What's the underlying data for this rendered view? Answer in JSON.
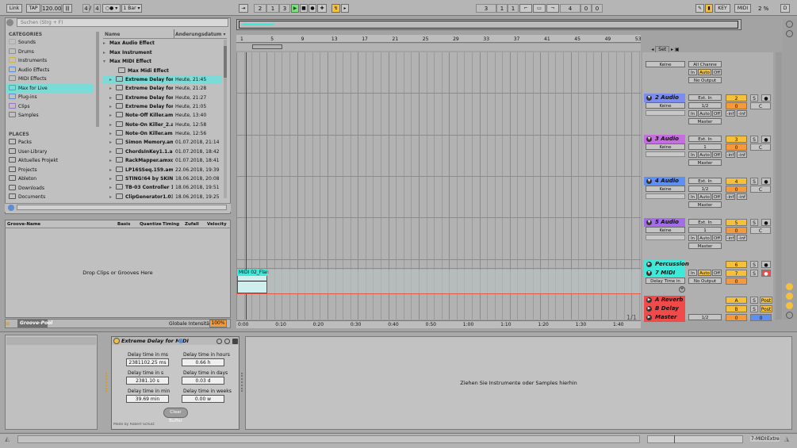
{
  "transport": {
    "link": "Link",
    "tap": "TAP",
    "tempo": "120.00",
    "sig_num": "4",
    "sig_den": "4",
    "metro": "○●",
    "quant": "1 Bar",
    "pos_bar": "2",
    "pos_beat": "1",
    "pos_six": "3",
    "loop_bar": "3",
    "loop_beat": "1",
    "loop_six": "1",
    "len_bar": "4",
    "len_beat": "0",
    "len_six": "0",
    "key": "KEY",
    "midi": "MIDI",
    "cpu": "2 %",
    "d": "D"
  },
  "browser": {
    "search_placeholder": "Suchen (Strg + F)",
    "categories_label": "CATEGORIES",
    "categories": [
      "Sounds",
      "Drums",
      "Instruments",
      "Audio Effects",
      "MIDI Effects",
      "Max for Live",
      "Plug-ins",
      "Clips",
      "Samples"
    ],
    "places_label": "PLACES",
    "places": [
      "Packs",
      "User-Library",
      "Aktuelles Projekt",
      "Projects",
      "Ableton",
      "Downloads",
      "Documents"
    ],
    "col_name": "Name",
    "col_date": "Änderungsdatum",
    "folders": [
      "Max Audio Effect",
      "Max Instrument",
      "Max MIDI Effect"
    ],
    "subfolder": "Max Midi Effect",
    "files": [
      {
        "name": "Extreme Delay for ...",
        "date": "Heute, 21:45"
      },
      {
        "name": "Extreme Delay for ...",
        "date": "Heute, 21:28"
      },
      {
        "name": "Extreme Delay for ...",
        "date": "Heute, 21:27"
      },
      {
        "name": "Extreme Delay for ...",
        "date": "Heute, 21:05"
      },
      {
        "name": "Note-Off Killer.amxd",
        "date": "Heute, 13:40"
      },
      {
        "name": "Note-On Killer_2.a...",
        "date": "Heute, 12:58"
      },
      {
        "name": "Note-On Killer.amxd",
        "date": "Heute, 12:56"
      },
      {
        "name": "Simon Memory.am...",
        "date": "01.07.2018, 21:14"
      },
      {
        "name": "ChordsInKey1.1.a...",
        "date": "01.07.2018, 18:42"
      },
      {
        "name": "RackMapper.amxd",
        "date": "01.07.2018, 18:41"
      },
      {
        "name": "LP16SSeq.159.amxd",
        "date": "22.06.2018, 19:39"
      },
      {
        "name": "STING!64 by SKIN...",
        "date": "18.06.2018, 20:08"
      },
      {
        "name": "TB-03 Controller 1...",
        "date": "18.06.2018, 19:51"
      },
      {
        "name": "ClipGenerator1.03....",
        "date": "18.06.2018, 19:25"
      }
    ]
  },
  "groove": {
    "headers": [
      "Groove-Name",
      "Basis",
      "Quantize",
      "Timing",
      "Zufall",
      "Velocity"
    ],
    "drop_text": "Drop Clips or Grooves Here",
    "pool_label": "Groove-Pool",
    "intensity_label": "Globale Intensität",
    "intensity_value": "100%"
  },
  "arrangement": {
    "ruler_bars": [
      "1",
      "5",
      "9",
      "13",
      "17",
      "21",
      "25",
      "29",
      "33",
      "37",
      "41",
      "45",
      "49",
      "53"
    ],
    "time_marks": [
      "0:00",
      "0:10",
      "0:20",
      "0:30",
      "0:40",
      "0:50",
      "1:00",
      "1:10",
      "1:20",
      "1:30",
      "1:40"
    ],
    "set_label": "Set",
    "fraction": "1/1",
    "clip_name": "MIDI 02_Flan"
  },
  "tracks": [
    {
      "name": "2 Audio",
      "color": "#7b8df0",
      "in": "Ext. In",
      "ch": "1/2",
      "out": "Master",
      "num": "2",
      "vol": "0",
      "pan": "C"
    },
    {
      "name": "3 Audio",
      "color": "#c66ee0",
      "in": "Ext. In",
      "ch": "1",
      "out": "Master",
      "num": "3",
      "vol": "0",
      "pan": "C"
    },
    {
      "name": "4 Audio",
      "color": "#5d8ff5",
      "in": "Ext. In",
      "ch": "1/2",
      "out": "Master",
      "num": "4",
      "vol": "0",
      "pan": "C"
    },
    {
      "name": "5 Audio",
      "color": "#a26de6",
      "in": "Ext. In",
      "ch": "1",
      "out": "Master",
      "num": "5",
      "vol": "0",
      "pan": "C"
    }
  ],
  "mixer": {
    "keine": "Keine",
    "all_channels": "All Channe",
    "no_output": "No Output",
    "in": "In",
    "auto": "Auto",
    "off": "Off",
    "inf": "-inf",
    "s": "S",
    "post": "Post",
    "percussion": "Percussion",
    "perc_num": "6",
    "midi_track": "7 MIDI",
    "midi_num": "7",
    "midi_vol": "0",
    "delay_time": "Delay Time in",
    "reverb": "A Reverb",
    "delay": "B Delay",
    "master": "Master",
    "ret_a": "A",
    "ret_b": "B",
    "master_out": "1/2",
    "master_vol": "0",
    "master_pan": "0",
    "top_keine": "Keine"
  },
  "device": {
    "title": "Extreme Delay for MIDI",
    "lbl_ms": "Delay time in ms",
    "val_ms": "2381102.25 ms",
    "lbl_hours": "Delay time in hours",
    "val_hours": "0.66 h",
    "lbl_s": "Delay time in s",
    "val_s": "2381.10 s",
    "lbl_days": "Delay time in days",
    "val_days": "0.03 d",
    "lbl_min": "Delay time in min",
    "val_min": "39.69 min",
    "lbl_weeks": "Delay time in weeks",
    "val_weeks": "0.00 w",
    "clear": "Clear Buffer",
    "credit": "Made by Robert Schulz",
    "drop_text": "Ziehen Sie Instrumente oder Samples hierhin"
  },
  "status": {
    "track": "7-MIDI",
    "device": "Extre"
  },
  "colors": {
    "select": "#7bdbd7",
    "track_yellow": "#f5c13d",
    "orange": "#f39a3c",
    "red_return": "#f04a4a",
    "perc": "#3ee9d9"
  }
}
